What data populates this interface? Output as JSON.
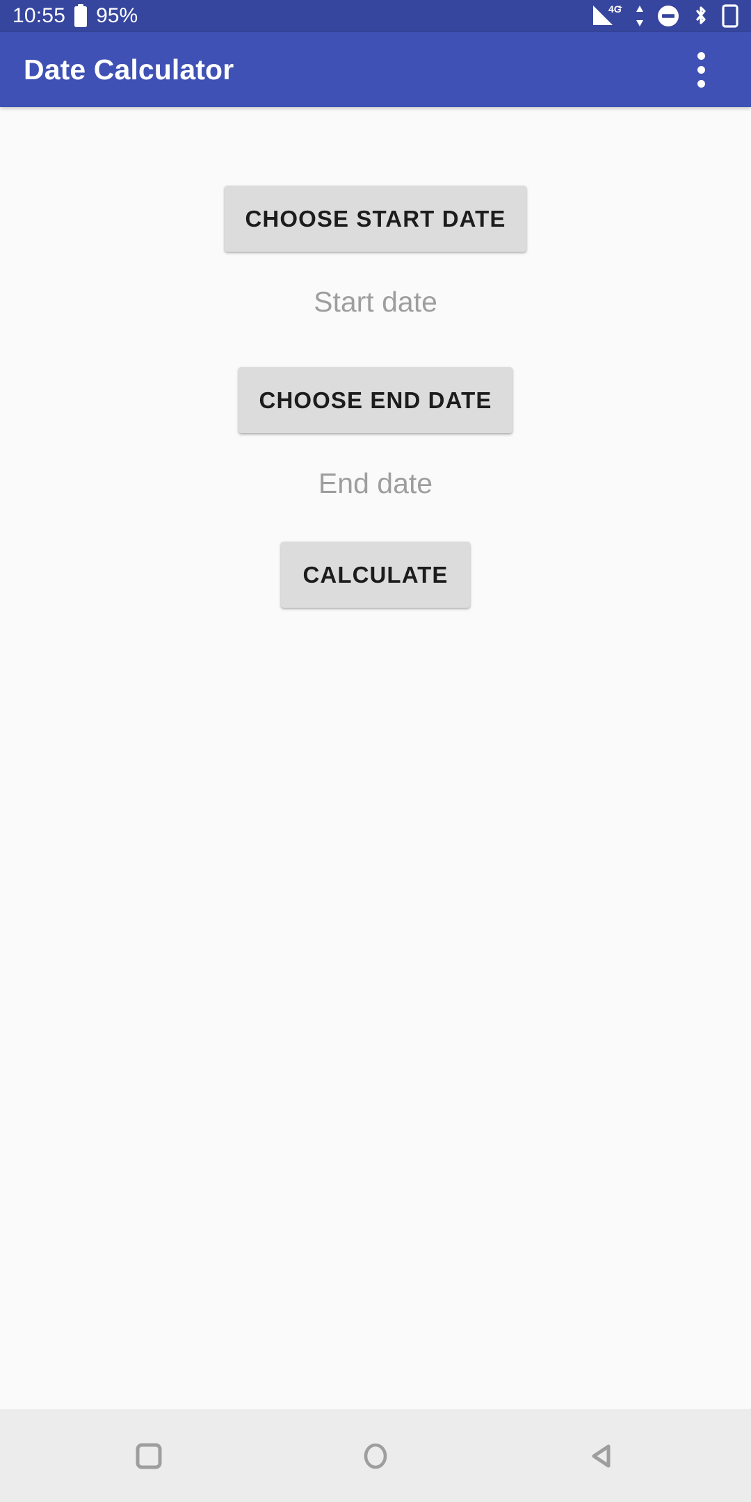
{
  "status_bar": {
    "time": "10:55",
    "battery_percent": "95%",
    "icons": [
      {
        "name": "battery-icon",
        "label": "battery-full"
      },
      {
        "name": "signal-icon",
        "label": "4G+"
      },
      {
        "name": "data-transfer-icon",
        "label": "up-down-arrows"
      },
      {
        "name": "do-not-disturb-icon",
        "label": "do-not-disturb"
      },
      {
        "name": "bluetooth-icon",
        "label": "bluetooth"
      },
      {
        "name": "device-icon",
        "label": "phone-device"
      }
    ],
    "network_label": "4G+",
    "background_color": "#36469e"
  },
  "app_bar": {
    "title": "Date Calculator",
    "overflow_menu_label": "More options",
    "background_color": "#3f51b5",
    "title_color": "#ffffff"
  },
  "main": {
    "start_button_label": "CHOOSE START DATE",
    "start_date_hint": "Start date",
    "end_button_label": "CHOOSE END DATE",
    "end_date_hint": "End date",
    "calculate_button_label": "CALCULATE",
    "background_color": "#fafafa",
    "button_color": "#dcdcdc",
    "hint_color": "#9e9e9e"
  },
  "nav_bar": {
    "recents_label": "Recents",
    "home_label": "Home",
    "back_label": "Back",
    "background_color": "#ececec",
    "icon_color": "#9e9e9e"
  }
}
